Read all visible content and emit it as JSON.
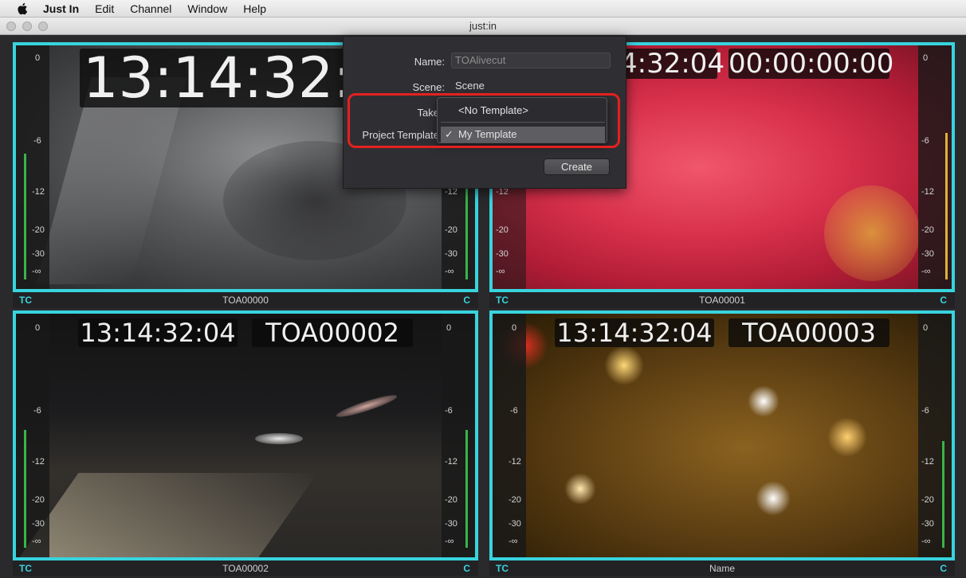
{
  "menubar": {
    "app": "Just In",
    "items": [
      "Edit",
      "Channel",
      "Window",
      "Help"
    ]
  },
  "window": {
    "title": "just:in"
  },
  "colors": {
    "accent": "#38d4de",
    "meter_green": "#39b44a",
    "highlight": "#e5201f"
  },
  "meter_ticks": [
    "0",
    "-6",
    "-12",
    "-20",
    "-30",
    "-∞"
  ],
  "panels": [
    {
      "timecode": "13:14:32:0",
      "name_overlay": "",
      "footer_name": "TOA00000",
      "tc_label": "TC",
      "c_label": "C"
    },
    {
      "timecode": "4:32:04",
      "name_overlay": "00:00:00:00",
      "footer_name": "TOA00001",
      "tc_label": "TC",
      "c_label": "C"
    },
    {
      "timecode": "13:14:32:04",
      "name_overlay": "TOA00002",
      "footer_name": "TOA00002",
      "tc_label": "TC",
      "c_label": "C"
    },
    {
      "timecode": "13:14:32:04",
      "name_overlay": "TOA00003",
      "footer_name": "Name",
      "tc_label": "TC",
      "c_label": "C"
    }
  ],
  "dialog": {
    "name_label": "Name:",
    "name_placeholder": "TOAlivecut",
    "scene_label": "Scene:",
    "scene_value": "Scene",
    "take_label": "Take",
    "project_template_label": "Project Template",
    "dropdown_options": [
      "<No Template>",
      "My Template"
    ],
    "selected_option": "My Template",
    "create_label": "Create"
  }
}
